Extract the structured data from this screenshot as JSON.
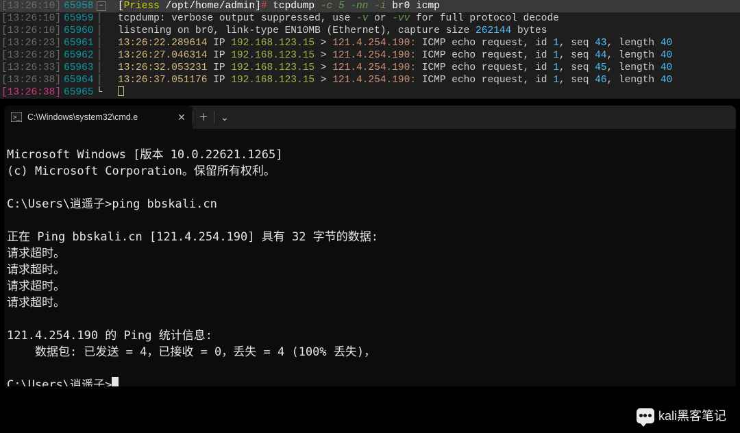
{
  "tcpdump": {
    "lines": [
      {
        "ts": "[13:26:10]",
        "ln": "65958",
        "fold": "⊟",
        "seg": "prompt",
        "prompt": {
          "lbr": "[",
          "host": "Priess",
          "path": " /opt/home/admin",
          "rbr": "]",
          "hash": "# "
        },
        "cmd": "tcpdump ",
        "flags1": "-c 5 -nn -i",
        "args": " br0 icmp"
      },
      {
        "ts": "[13:26:10]",
        "ln": "65959",
        "seg": "text1",
        "pre": "tcpdump: verbose output suppressed, use ",
        "f1": "-v",
        "mid": " or ",
        "f2": "-vv",
        "post": " for full protocol decode"
      },
      {
        "ts": "[13:26:10]",
        "ln": "65960",
        "seg": "text2",
        "pre": "listening on br0, link-type EN10MB (Ethernet), capture size ",
        "num": "262144",
        "post": " bytes"
      },
      {
        "ts": "[13:26:23]",
        "ln": "65961",
        "seg": "pkt",
        "time": "13:26:22.289614",
        "id": "1",
        "seq": "43",
        "len": "40"
      },
      {
        "ts": "[13:26:28]",
        "ln": "65962",
        "seg": "pkt",
        "time": "13:26:27.046314",
        "id": "1",
        "seq": "44",
        "len": "40"
      },
      {
        "ts": "[13:26:33]",
        "ln": "65963",
        "seg": "pkt",
        "time": "13:26:32.053231",
        "id": "1",
        "seq": "45",
        "len": "40"
      },
      {
        "ts": "[13:26:38]",
        "ln": "65964",
        "seg": "pkt",
        "time": "13:26:37.051176",
        "id": "1",
        "seq": "46",
        "len": "40"
      },
      {
        "ts": "[13:26:38]",
        "ln": "65965",
        "seg": "cursor",
        "magenta": true
      }
    ],
    "packet": {
      "ip_kw": " IP ",
      "src": "192.168.123.15",
      "arrow": " > ",
      "dst": "121.4.254.190",
      "colon": ":",
      "msg": " ICMP echo request, id ",
      "seq_label": ", seq ",
      "len_label": ", length "
    }
  },
  "windows": {
    "tab_title": "C:\\Windows\\system32\\cmd.e",
    "body": {
      "l1": "Microsoft Windows [版本 10.0.22621.1265]",
      "l2": "(c) Microsoft Corporation。保留所有权利。",
      "blank": "",
      "prompt1": "C:\\Users\\逍遥子>",
      "cmd1": "ping bbskali.cn",
      "l3": "正在 Ping bbskali.cn [121.4.254.190] 具有 32 字节的数据:",
      "timeout": "请求超时。",
      "l4": "121.4.254.190 的 Ping 统计信息:",
      "l5": "    数据包: 已发送 = 4，已接收 = 0，丢失 = 4 (100% 丢失)，",
      "prompt2": "C:\\Users\\逍遥子>"
    }
  },
  "watermark": "kali黑客笔记"
}
